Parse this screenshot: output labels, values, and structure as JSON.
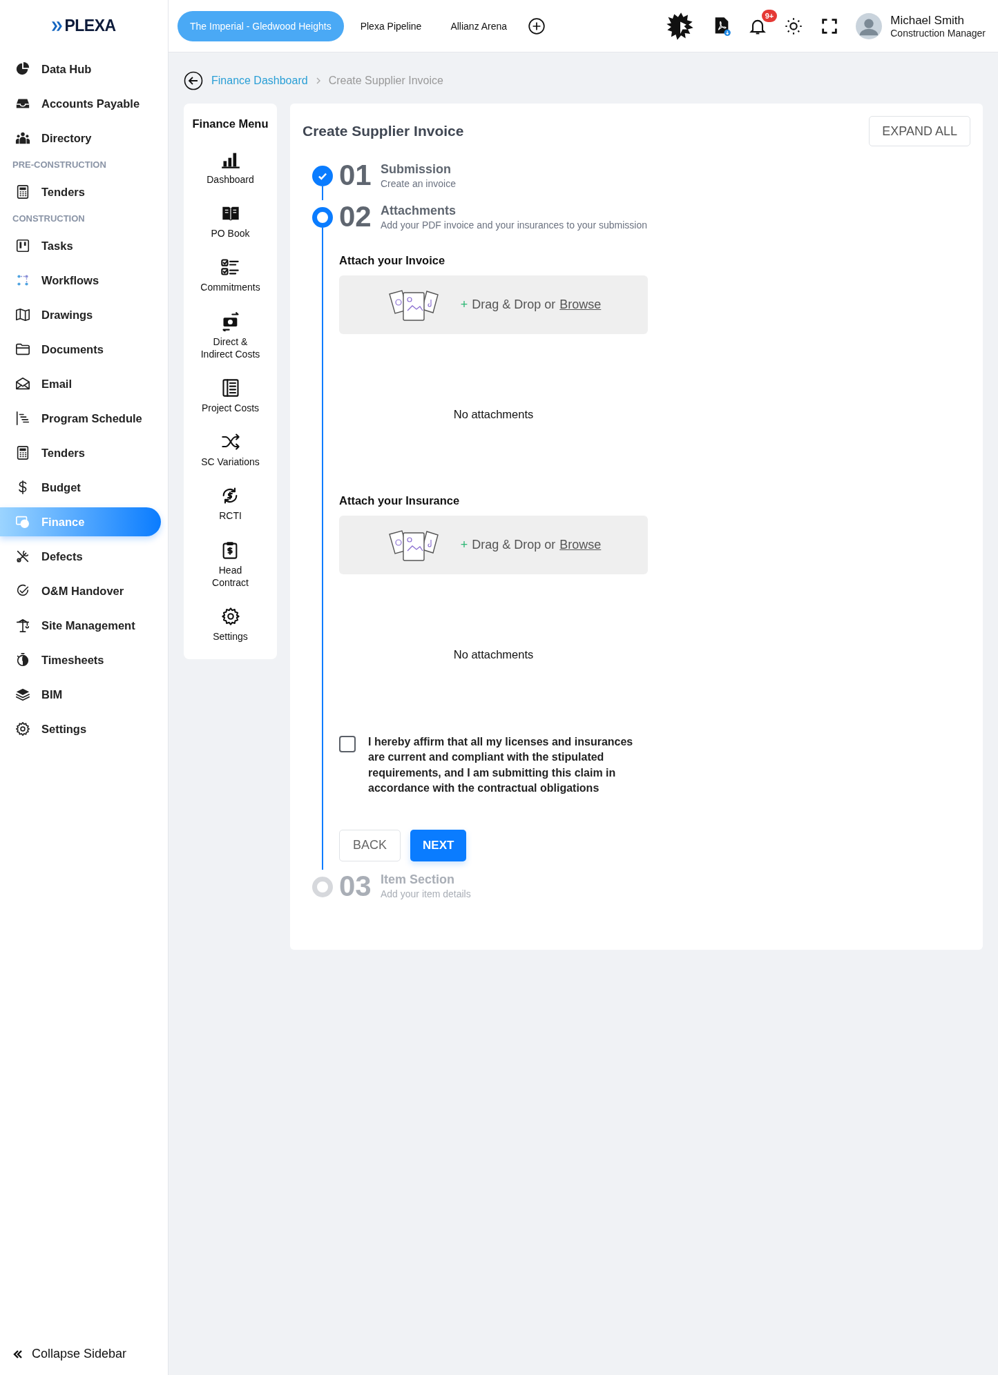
{
  "logo": {
    "text": "PLEXA"
  },
  "project_tabs": [
    {
      "label": "The Imperial - Gledwood Heights",
      "selected": true
    },
    {
      "label": "Plexa Pipeline",
      "selected": false
    },
    {
      "label": "Allianz Arena",
      "selected": false
    }
  ],
  "notifications": {
    "badge": "9+"
  },
  "user": {
    "name": "Michael Smith",
    "role": "Construction Manager"
  },
  "sidebar": {
    "items": [
      {
        "kind": "item",
        "label": "Data Hub",
        "selected": false
      },
      {
        "kind": "item",
        "label": "Accounts Payable",
        "selected": false
      },
      {
        "kind": "item",
        "label": "Directory",
        "selected": false
      },
      {
        "kind": "section",
        "label": "PRE-CONSTRUCTION"
      },
      {
        "kind": "item",
        "label": "Tenders",
        "selected": false
      },
      {
        "kind": "section",
        "label": "CONSTRUCTION"
      },
      {
        "kind": "item",
        "label": "Tasks",
        "selected": false
      },
      {
        "kind": "item",
        "label": "Workflows",
        "selected": false
      },
      {
        "kind": "item",
        "label": "Drawings",
        "selected": false
      },
      {
        "kind": "item",
        "label": "Documents",
        "selected": false
      },
      {
        "kind": "item",
        "label": "Email",
        "selected": false
      },
      {
        "kind": "item",
        "label": "Program Schedule",
        "selected": false
      },
      {
        "kind": "item",
        "label": "Tenders",
        "selected": false
      },
      {
        "kind": "item",
        "label": "Budget",
        "selected": false
      },
      {
        "kind": "item",
        "label": "Finance",
        "selected": true
      },
      {
        "kind": "item",
        "label": "Defects",
        "selected": false
      },
      {
        "kind": "item",
        "label": "O&M Handover",
        "selected": false
      },
      {
        "kind": "item",
        "label": "Site Management",
        "selected": false
      },
      {
        "kind": "item",
        "label": "Timesheets",
        "selected": false
      },
      {
        "kind": "item",
        "label": "BIM",
        "selected": false
      },
      {
        "kind": "item",
        "label": "Settings",
        "selected": false
      }
    ],
    "collapse": "Collapse Sidebar"
  },
  "breadcrumb": {
    "link": "Finance Dashboard",
    "current": "Create Supplier Invoice"
  },
  "finance_menu": {
    "title": "Finance Menu",
    "items": [
      {
        "label": "Dashboard"
      },
      {
        "label": "PO Book"
      },
      {
        "label": "Commitments"
      },
      {
        "label": "Direct &\nIndirect Costs"
      },
      {
        "label": "Project Costs"
      },
      {
        "label": "SC Variations"
      },
      {
        "label": "RCTI"
      },
      {
        "label": "Head\nContract"
      },
      {
        "label": "Settings"
      }
    ]
  },
  "form": {
    "title": "Create Supplier Invoice",
    "expand_button": "EXPAND ALL",
    "steps": [
      {
        "number": "01",
        "title": "Submission",
        "subtitle": "Create an invoice",
        "completed": true,
        "current": false
      },
      {
        "number": "02",
        "title": "Attachments",
        "subtitle": "Add your PDF invoice and your insurances to your submission",
        "completed": false,
        "current": true
      },
      {
        "number": "03",
        "title": "Item Section",
        "subtitle": "Add your item details",
        "completed": false,
        "current": false
      }
    ],
    "attachments": [
      {
        "heading": "Attach your Invoice",
        "plus": "+",
        "drop_text": "Drag & Drop or",
        "browse": "Browse",
        "empty": "No attachments"
      },
      {
        "heading": "Attach your Insurance",
        "plus": "+",
        "drop_text": "Drag & Drop or",
        "browse": "Browse",
        "empty": "No attachments"
      }
    ],
    "affirmation": {
      "checked": false,
      "text": "I hereby affirm that all my licenses and insurances are current and compliant with the stipulated requirements, and I am submitting this claim in accordance with the contractual obligations"
    },
    "back_button": "BACK",
    "next_button": "NEXT"
  }
}
